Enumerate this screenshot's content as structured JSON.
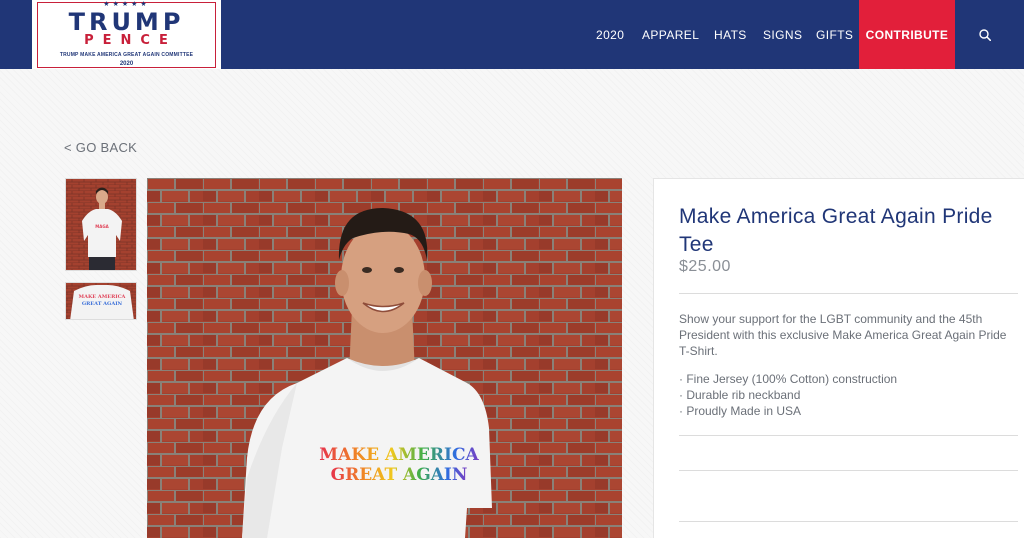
{
  "header": {
    "logo": {
      "stars": "★★★★★",
      "line1": "TRUMP",
      "line2": "PENCE",
      "committee": "TRUMP MAKE AMERICA GREAT AGAIN COMMITTEE",
      "year": "2020"
    },
    "nav": [
      {
        "label": "2020"
      },
      {
        "label": "APPAREL"
      },
      {
        "label": "HATS"
      },
      {
        "label": "SIGNS"
      },
      {
        "label": "GIFTS"
      }
    ],
    "contribute_label": "CONTRIBUTE",
    "search_icon": "search-icon"
  },
  "go_back": "< GO BACK",
  "product": {
    "title": "Make America Great Again Pride Tee",
    "price": "$25.00",
    "description": "Show your support for the LGBT community and the 45th President with this exclusive Make America Great Again Pride T-Shirt.",
    "features": [
      "· Fine Jersey (100% Cotton) construction",
      "· Durable rib neckband",
      "· Proudly Made in USA"
    ],
    "shirt_print": {
      "line1": "MAKE AMERICA",
      "line2": "GREAT AGAIN"
    }
  },
  "colors": {
    "navy": "#203677",
    "red": "#e21f3a",
    "brick": "#a4412f"
  }
}
